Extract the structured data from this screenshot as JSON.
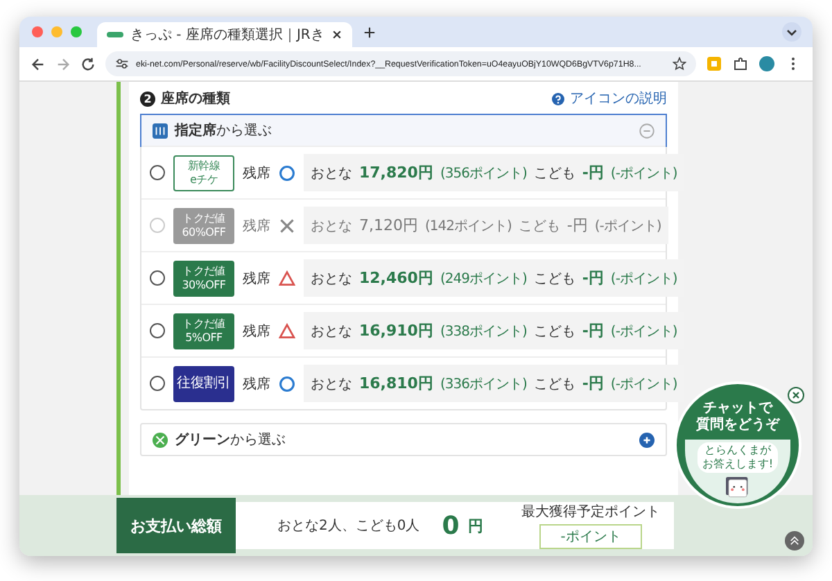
{
  "browser": {
    "tab_title": "きっぷ - 座席の種類選択｜JRき",
    "url": "eki-net.com/Personal/reserve/wb/FacilityDiscountSelect/Index?__RequestVerificationToken=uO4eayuOBjY10WQD6BgVTV6p71H8..."
  },
  "section": {
    "number": "2",
    "title": "座席の種類",
    "help_link": "アイコンの説明"
  },
  "seat_group": {
    "label": "**指定席**から選ぶ",
    "expanded": true,
    "rows": [
      {
        "selected": false,
        "disabled": false,
        "badge": {
          "kind": "outline",
          "lines": [
            "新幹線",
            "eチケ"
          ]
        },
        "seat_label": "残席",
        "availability": {
          "kind": "circle"
        },
        "adult_label": "おとな",
        "adult_price": "17,820円",
        "adult_points": "(356ポイント)",
        "child_label": "こども",
        "child_price": "-円",
        "child_points": "(-ポイント)"
      },
      {
        "selected": false,
        "disabled": true,
        "badge": {
          "kind": "grey",
          "lines": [
            "トクだ値",
            "60%OFF"
          ]
        },
        "seat_label": "残席",
        "availability": {
          "kind": "cross"
        },
        "adult_label": "おとな",
        "adult_price": "7,120円",
        "adult_points": "(142ポイント)",
        "child_label": "こども",
        "child_price": "-円",
        "child_points": "(-ポイント)"
      },
      {
        "selected": false,
        "disabled": false,
        "badge": {
          "kind": "green",
          "lines": [
            "トクだ値",
            "30%OFF"
          ]
        },
        "seat_label": "残席",
        "availability": {
          "kind": "triangle"
        },
        "adult_label": "おとな",
        "adult_price": "12,460円",
        "adult_points": "(249ポイント)",
        "child_label": "こども",
        "child_price": "-円",
        "child_points": "(-ポイント)"
      },
      {
        "selected": false,
        "disabled": false,
        "badge": {
          "kind": "green",
          "lines": [
            "トクだ値",
            "5%OFF"
          ]
        },
        "seat_label": "残席",
        "availability": {
          "kind": "triangle"
        },
        "adult_label": "おとな",
        "adult_price": "16,910円",
        "adult_points": "(338ポイント)",
        "child_label": "こども",
        "child_price": "-円",
        "child_points": "(-ポイント)"
      },
      {
        "selected": false,
        "disabled": false,
        "badge": {
          "kind": "navy",
          "lines": [
            "往復割引"
          ]
        },
        "seat_label": "残席",
        "availability": {
          "kind": "circle"
        },
        "adult_label": "おとな",
        "adult_price": "16,810円",
        "adult_points": "(336ポイント)",
        "child_label": "こども",
        "child_price": "-円",
        "child_points": "(-ポイント)"
      }
    ]
  },
  "green_group": {
    "label": "**グリーン**から選ぶ",
    "expanded": false
  },
  "total_bar": {
    "label": "お支払い総額",
    "passengers": "おとな2人、こども0人",
    "amount": "0",
    "currency": "円",
    "points_label": "最大獲得予定ポイント",
    "points_value": "-ポイント"
  },
  "chat": {
    "title_lines": [
      "チャットで",
      "質問をどうぞ"
    ],
    "speech_lines": [
      "とらんくまが",
      "お答えします!"
    ]
  }
}
